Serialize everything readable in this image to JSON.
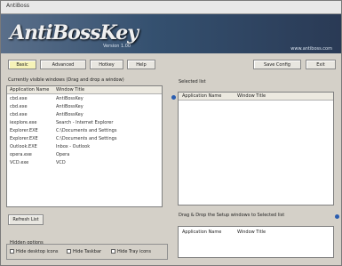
{
  "window": {
    "title": "AntiBoss"
  },
  "banner": {
    "logo": "AntiBossKey",
    "version": "Version 1.00",
    "site": "www.antiboss.com"
  },
  "toolbar": {
    "tabs": [
      "Basic",
      "Advanced",
      "Hotkey",
      "Help"
    ],
    "right_buttons": [
      "Save Config",
      "Exit"
    ]
  },
  "left": {
    "caption": "Currently visible windows (Drag and drop a window)",
    "columns": [
      "Application Name",
      "Window Title"
    ],
    "rows": [
      [
        "cbd.exe",
        "AntiBossKey"
      ],
      [
        "cbd.exe",
        "AntiBossKey"
      ],
      [
        "cbd.exe",
        "AntiBossKey"
      ],
      [
        "iexplore.exe",
        "Search - Internet Explorer"
      ],
      [
        "Explorer.EXE",
        "C:\\Documents and Settings"
      ],
      [
        "Explorer.EXE",
        "C:\\Documents and Settings"
      ],
      [
        "Outlook.EXE",
        "Inbox - Outlook"
      ],
      [
        "opera.exe",
        "Opera"
      ],
      [
        "VCD.exe",
        "VCD"
      ]
    ]
  },
  "right": {
    "caption": "Selected list",
    "columns": [
      "Application Name",
      "Window Title"
    ]
  },
  "bottom_right": {
    "caption": "Drag & Drop the Setup windows to Selected list",
    "columns": [
      "Application Name",
      "Window Title"
    ]
  },
  "refresh_label": "Refresh List",
  "options": {
    "legend": "Hidden options",
    "items": [
      "Hide desktop icons",
      "Hide Taskbar",
      "Hide Tray icons"
    ]
  }
}
